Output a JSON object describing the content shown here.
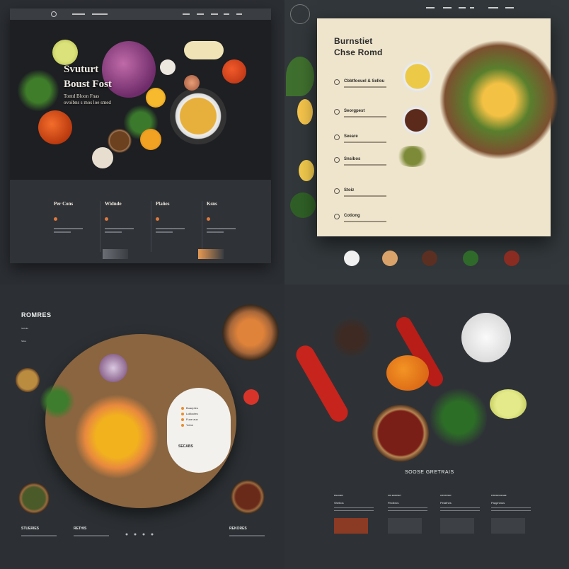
{
  "q1": {
    "nav": [
      "",
      "",
      "",
      "",
      "",
      ""
    ],
    "hero": {
      "line1": "Svuturt",
      "line2": "Boust Fost",
      "sub1": "Tontd Bloon Fnas",
      "sub2": "ovoibns s mos loe smed"
    },
    "columns": [
      {
        "title": "Per Cons"
      },
      {
        "title": "Widnde"
      },
      {
        "title": "Plañes"
      },
      {
        "title": "Ksns"
      }
    ]
  },
  "q2": {
    "title_line1": "Burnstiet",
    "title_line2": "Chse Romd",
    "items": [
      "Cbbtfoouel & Sellou",
      "Seorgpest",
      "Seeare",
      "Snsibos",
      "Stoiz",
      "Cotiong"
    ]
  },
  "q3": {
    "heading": "ROMRES",
    "side1": "Stctolte",
    "side2": "Silico",
    "panel": {
      "items": [
        "Buaepfes",
        "Lollioctes",
        "Fuoe auz",
        "Yotne"
      ],
      "heading": "SECABS"
    },
    "bottom": [
      "STUERIES",
      "RETHIS",
      "REKORES"
    ]
  },
  "q4": {
    "headline": "SOOSE GRETRAIS",
    "cols": [
      {
        "h": "DSANER",
        "p": "Shebos"
      },
      {
        "h": "UIS BUDISET",
        "p": "Flvdbros"
      },
      {
        "h": "CROSTIER",
        "p": "Petafhes"
      },
      {
        "h": "FROSES BABE",
        "p": "Papphmos"
      }
    ]
  },
  "colors": {
    "accent": "#e0793a",
    "cream": "#efe5cd",
    "dark": "#26292d"
  }
}
